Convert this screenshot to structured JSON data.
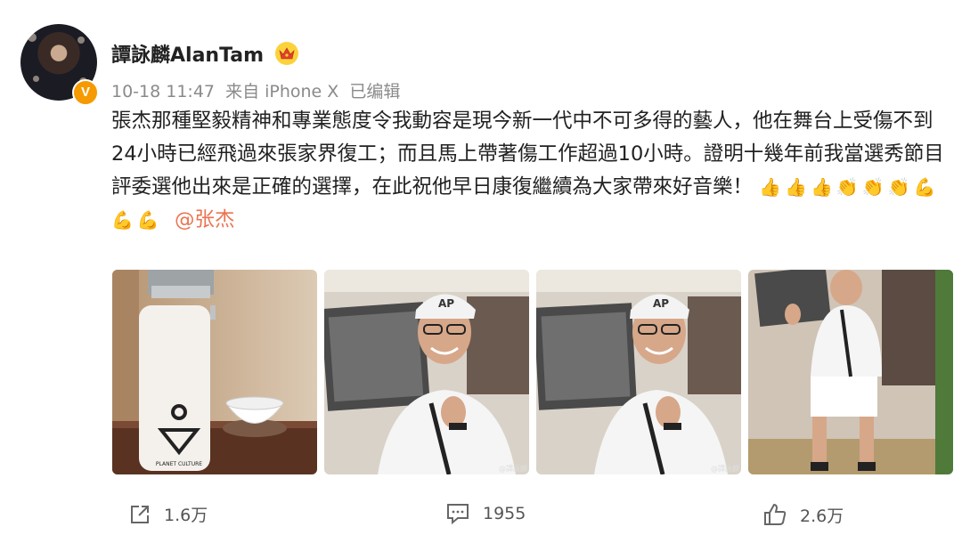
{
  "author": {
    "name": "譚詠麟AlanTam",
    "verified_badge": "V",
    "avatar_icon": "avatar",
    "crown_icon": "crown-icon"
  },
  "meta": {
    "time": "10-18 11:47",
    "source": "来自 iPhone X",
    "edited": "已编辑"
  },
  "post": {
    "text": "張杰那種堅毅精神和專業態度令我動容是現今新一代中不可多得的藝人，他在舞台上受傷不到24小時已經飛過來張家界復工；而且馬上帶著傷工作超過10小時。證明十幾年前我當選秀節目評委選他出來是正確的選擇，在此祝他早日康復繼續為大家帶來好音樂！",
    "emojis": [
      "👍",
      "👍",
      "👍",
      "👏",
      "👏",
      "👏",
      "💪",
      "💪",
      "💪"
    ],
    "mention": "@张杰"
  },
  "photos": {
    "bottle_logo_text": "PLANET CULTURE",
    "cap_logo": "AP",
    "watermark": "@譚詠麟"
  },
  "actions": {
    "share_count": "1.6万",
    "comment_count": "1955",
    "like_count": "2.6万"
  },
  "colors": {
    "mention": "#eb7350",
    "badge": "#f59a00",
    "crown": "#fbd23a"
  }
}
